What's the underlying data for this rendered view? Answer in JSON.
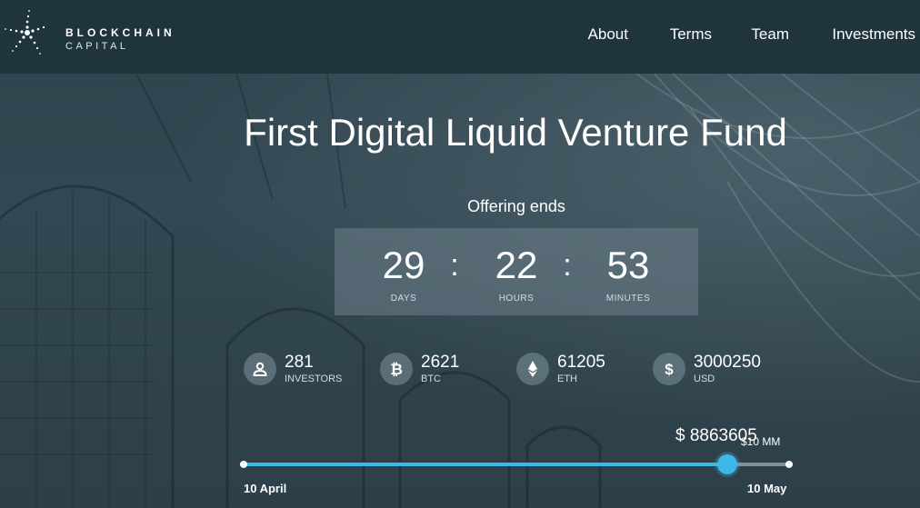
{
  "brand": {
    "line1": "BLOCKCHAIN",
    "line2": "CAPITAL",
    "icon": "starburst-logo-icon"
  },
  "nav": {
    "items": [
      {
        "label": "About"
      },
      {
        "label": "Terms"
      },
      {
        "label": "Team"
      },
      {
        "label": "Investments"
      }
    ]
  },
  "hero": {
    "title": "First Digital Liquid Venture Fund",
    "offering_label": "Offering ends"
  },
  "countdown": {
    "days": {
      "value": "29",
      "label": "DAYS"
    },
    "hours": {
      "value": "22",
      "label": "HOURS"
    },
    "minutes": {
      "value": "53",
      "label": "MINUTES"
    },
    "separator": ":"
  },
  "stats": [
    {
      "icon": "person-icon",
      "value": "281",
      "label": "INVESTORS"
    },
    {
      "icon": "bitcoin-icon",
      "value": "2621",
      "label": "BTC"
    },
    {
      "icon": "ethereum-icon",
      "value": "61205",
      "label": "ETH"
    },
    {
      "icon": "dollar-icon",
      "value": "3000250",
      "label": "USD"
    }
  ],
  "progress": {
    "amount": "$ 8863605",
    "goal": "$10 MM",
    "start_date": "10 April",
    "end_date": "10 May",
    "fraction": 0.886
  },
  "colors": {
    "header_bg": "#1f343d",
    "accent": "#3cb7e6",
    "page_bg": "#2f434d"
  }
}
